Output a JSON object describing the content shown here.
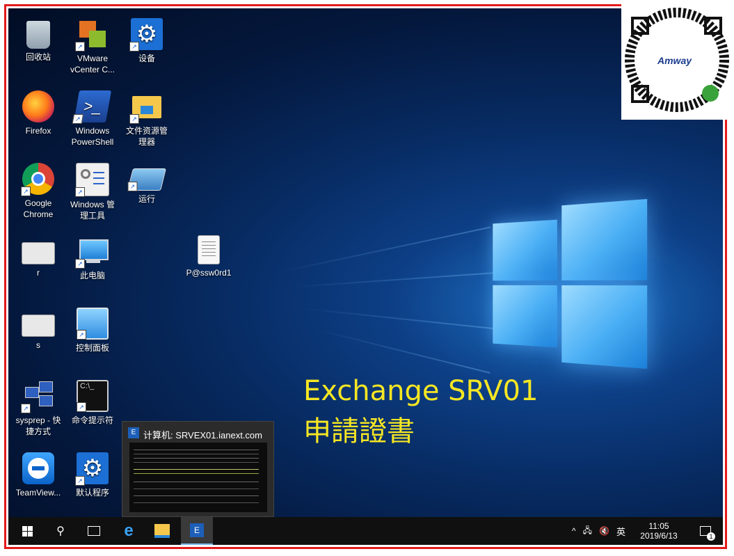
{
  "desktop": {
    "icons": [
      {
        "label": "回收站",
        "icon": "recycle-bin-icon"
      },
      {
        "label": "VMware vCenter C...",
        "icon": "vmware-icon"
      },
      {
        "label": "设备",
        "icon": "settings-gear-icon"
      },
      {
        "label": "Firefox",
        "icon": "firefox-icon"
      },
      {
        "label": "Windows PowerShell",
        "icon": "powershell-icon"
      },
      {
        "label": "文件资源管理器",
        "icon": "file-explorer-icon"
      },
      {
        "label": "Google Chrome",
        "icon": "chrome-icon"
      },
      {
        "label": "Windows 管理工具",
        "icon": "admin-tools-icon"
      },
      {
        "label": "运行",
        "icon": "run-icon"
      },
      {
        "label": "r",
        "icon": "config-file-icon"
      },
      {
        "label": "此电脑",
        "icon": "this-pc-icon"
      },
      {
        "label": "P@ssw0rd1",
        "icon": "text-file-icon"
      },
      {
        "label": "s",
        "icon": "config-file-icon"
      },
      {
        "label": "控制面板",
        "icon": "control-panel-icon"
      },
      {
        "label": "sysprep - 快捷方式",
        "icon": "sysprep-icon"
      },
      {
        "label": "命令提示符",
        "icon": "cmd-icon"
      },
      {
        "label": "TeamView...",
        "icon": "teamviewer-icon"
      },
      {
        "label": "默认程序",
        "icon": "default-programs-icon"
      }
    ],
    "overlay_line1": "Exchange SRV01",
    "overlay_line2": "申請證書",
    "overlay_color": "#f6e623"
  },
  "watermark": {
    "text": "Amway"
  },
  "taskbar": {
    "buttons": [
      "start-icon",
      "search-icon",
      "task-view-icon",
      "edge-icon",
      "file-explorer-icon",
      "exchange-shell-icon"
    ],
    "preview_title": "计算机: SRVEX01.ianext.com",
    "tray": {
      "ime": "英",
      "time": "11:05",
      "date": "2019/6/13",
      "notification_count": "1"
    }
  },
  "colors": {
    "frame": "#e21b1b",
    "taskbar": "#101010",
    "accent": "#76b9ed"
  }
}
